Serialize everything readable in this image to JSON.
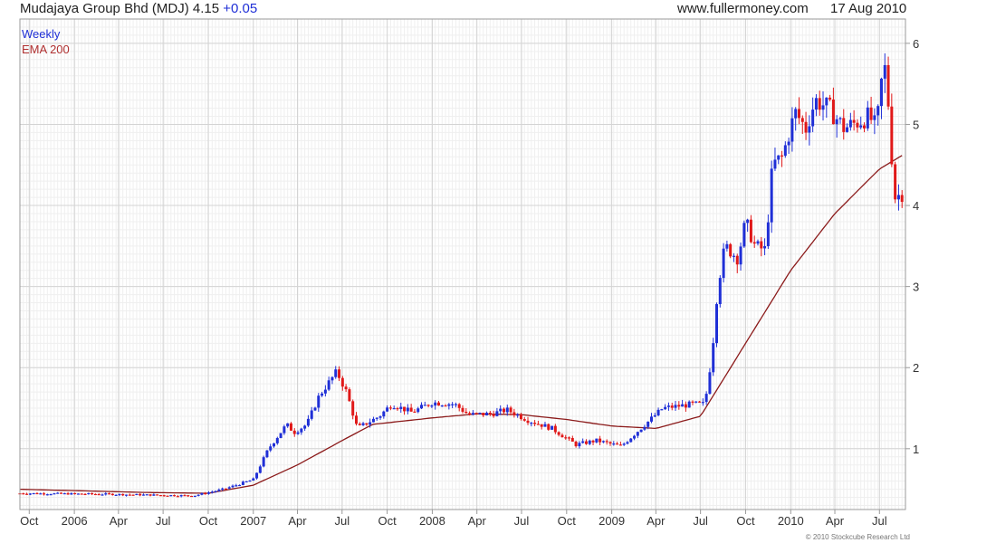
{
  "header": {
    "title": "Mudajaya Group Bhd (MDJ) 4.15",
    "change": "+0.05",
    "site": "www.fullermoney.com",
    "date": "17 Aug 2010"
  },
  "legend": {
    "primary": "Weekly",
    "secondary": "EMA 200"
  },
  "copyright": "© 2010 Stockcube Research Ltd",
  "colors": {
    "up": "#1f2fd6",
    "down": "#e01818",
    "ema": "#8b1a1a",
    "grid": "#d4d4d4",
    "frame": "#9a9a9a"
  },
  "chart_data": {
    "type": "candlestick",
    "title": "Mudajaya Group Bhd (MDJ)",
    "frequency": "Weekly",
    "ylim": [
      0.25,
      6.3
    ],
    "y_ticks": [
      1,
      2,
      3,
      4,
      5,
      6
    ],
    "x_range": [
      "2005-09-12",
      "2010-08-23"
    ],
    "x_ticks": [
      {
        "label": "Oct",
        "date": "2005-10-01"
      },
      {
        "label": "2006",
        "date": "2006-01-01"
      },
      {
        "label": "Apr",
        "date": "2006-04-01"
      },
      {
        "label": "Jul",
        "date": "2006-07-01"
      },
      {
        "label": "Oct",
        "date": "2006-10-01"
      },
      {
        "label": "2007",
        "date": "2007-01-01"
      },
      {
        "label": "Apr",
        "date": "2007-04-01"
      },
      {
        "label": "Jul",
        "date": "2007-07-01"
      },
      {
        "label": "Oct",
        "date": "2007-10-01"
      },
      {
        "label": "2008",
        "date": "2008-01-01"
      },
      {
        "label": "Apr",
        "date": "2008-04-01"
      },
      {
        "label": "Jul",
        "date": "2008-07-01"
      },
      {
        "label": "Oct",
        "date": "2008-10-01"
      },
      {
        "label": "2009",
        "date": "2009-01-01"
      },
      {
        "label": "Apr",
        "date": "2009-04-01"
      },
      {
        "label": "Jul",
        "date": "2009-07-01"
      },
      {
        "label": "Oct",
        "date": "2009-10-01"
      },
      {
        "label": "2010",
        "date": "2010-01-01"
      },
      {
        "label": "Apr",
        "date": "2010-04-01"
      },
      {
        "label": "Jul",
        "date": "2010-07-01"
      }
    ],
    "price_anchors": [
      {
        "date": "2005-09-12",
        "close": 0.45
      },
      {
        "date": "2006-03-01",
        "close": 0.44
      },
      {
        "date": "2006-09-01",
        "close": 0.42
      },
      {
        "date": "2006-11-01",
        "close": 0.5
      },
      {
        "date": "2007-01-01",
        "close": 0.62
      },
      {
        "date": "2007-02-01",
        "close": 1.0
      },
      {
        "date": "2007-03-10",
        "close": 1.3
      },
      {
        "date": "2007-03-25",
        "close": 1.2
      },
      {
        "date": "2007-04-20",
        "close": 1.3
      },
      {
        "date": "2007-05-15",
        "close": 1.65
      },
      {
        "date": "2007-06-20",
        "close": 1.95
      },
      {
        "date": "2007-07-10",
        "close": 1.7
      },
      {
        "date": "2007-08-01",
        "close": 1.25
      },
      {
        "date": "2007-09-15",
        "close": 1.4
      },
      {
        "date": "2007-10-10",
        "close": 1.55
      },
      {
        "date": "2007-11-20",
        "close": 1.45
      },
      {
        "date": "2008-01-01",
        "close": 1.57
      },
      {
        "date": "2008-02-15",
        "close": 1.55
      },
      {
        "date": "2008-03-15",
        "close": 1.42
      },
      {
        "date": "2008-05-01",
        "close": 1.43
      },
      {
        "date": "2008-06-01",
        "close": 1.48
      },
      {
        "date": "2008-07-15",
        "close": 1.35
      },
      {
        "date": "2008-09-01",
        "close": 1.25
      },
      {
        "date": "2008-10-20",
        "close": 1.05
      },
      {
        "date": "2008-12-01",
        "close": 1.1
      },
      {
        "date": "2009-01-20",
        "close": 1.03
      },
      {
        "date": "2009-03-01",
        "close": 1.25
      },
      {
        "date": "2009-04-15",
        "close": 1.5
      },
      {
        "date": "2009-06-15",
        "close": 1.55
      },
      {
        "date": "2009-07-10",
        "close": 1.55
      },
      {
        "date": "2009-07-25",
        "close": 2.2
      },
      {
        "date": "2009-08-05",
        "close": 3.0
      },
      {
        "date": "2009-08-20",
        "close": 3.5
      },
      {
        "date": "2009-09-15",
        "close": 3.35
      },
      {
        "date": "2009-10-01",
        "close": 3.8
      },
      {
        "date": "2009-10-20",
        "close": 3.5
      },
      {
        "date": "2009-11-10",
        "close": 3.45
      },
      {
        "date": "2009-11-25",
        "close": 4.5
      },
      {
        "date": "2009-12-15",
        "close": 4.6
      },
      {
        "date": "2010-01-10",
        "close": 5.15
      },
      {
        "date": "2010-02-01",
        "close": 4.95
      },
      {
        "date": "2010-02-20",
        "close": 5.3
      },
      {
        "date": "2010-03-20",
        "close": 5.2
      },
      {
        "date": "2010-04-20",
        "close": 4.95
      },
      {
        "date": "2010-06-10",
        "close": 5.1
      },
      {
        "date": "2010-06-25",
        "close": 4.95
      },
      {
        "date": "2010-07-10",
        "close": 5.8
      },
      {
        "date": "2010-07-20",
        "close": 5.2
      },
      {
        "date": "2010-07-31",
        "close": 4.1
      },
      {
        "date": "2010-08-17",
        "close": 4.15
      }
    ],
    "ema200_anchors": [
      {
        "date": "2005-09-12",
        "value": 0.5
      },
      {
        "date": "2006-06-01",
        "value": 0.46
      },
      {
        "date": "2006-10-01",
        "value": 0.45
      },
      {
        "date": "2007-01-01",
        "value": 0.55
      },
      {
        "date": "2007-04-01",
        "value": 0.8
      },
      {
        "date": "2007-07-01",
        "value": 1.1
      },
      {
        "date": "2007-09-01",
        "value": 1.3
      },
      {
        "date": "2008-01-01",
        "value": 1.38
      },
      {
        "date": "2008-04-01",
        "value": 1.43
      },
      {
        "date": "2008-07-01",
        "value": 1.42
      },
      {
        "date": "2008-10-01",
        "value": 1.36
      },
      {
        "date": "2009-01-01",
        "value": 1.28
      },
      {
        "date": "2009-04-01",
        "value": 1.25
      },
      {
        "date": "2009-07-01",
        "value": 1.4
      },
      {
        "date": "2009-10-01",
        "value": 2.3
      },
      {
        "date": "2010-01-01",
        "value": 3.2
      },
      {
        "date": "2010-04-01",
        "value": 3.9
      },
      {
        "date": "2010-07-01",
        "value": 4.45
      },
      {
        "date": "2010-08-17",
        "value": 4.62
      }
    ]
  }
}
